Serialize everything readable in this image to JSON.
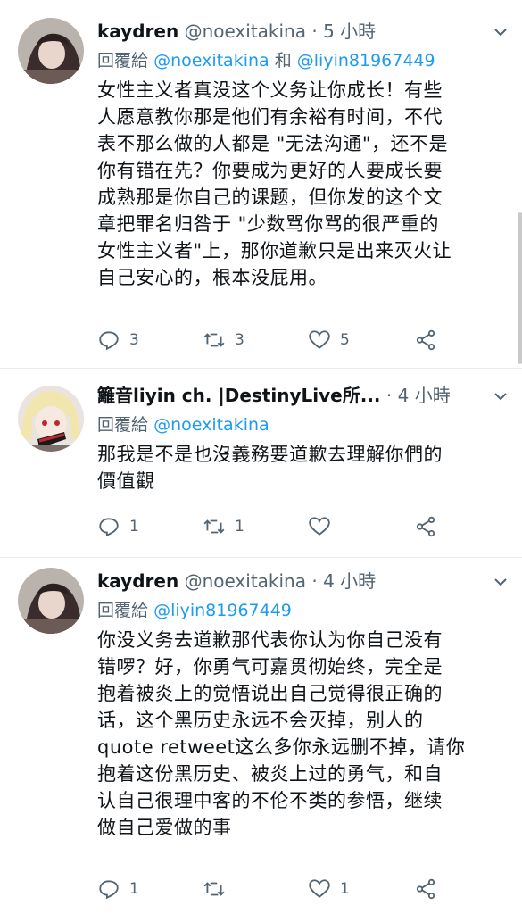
{
  "tweets": [
    {
      "name": "kaydren",
      "handle": "@noexitakina",
      "dot": "·",
      "time": "5 小時",
      "reply_prefix": "回覆給",
      "mentions": [
        "@noexitakina",
        "@liyin81967449"
      ],
      "mention_joiner": "和",
      "text_lines": [
        "女性主义者真没这个义务让你成长！有些",
        "人愿意教你那是他们有余裕有时间，不代",
        "表不那么做的人都是 \"无法沟通\"，还不是",
        "你有错在先？你要成为更好的人要成长要",
        "成熟那是你自己的课题，但你发的这个文",
        "章把罪名归咎于 \"少数骂你骂的很严重的",
        "女性主义者\"上，那你道歉只是出来灭火让",
        "自己安心的，根本没屁用。"
      ],
      "counts": {
        "reply": "3",
        "retweet": "3",
        "like": "5"
      }
    },
    {
      "name": "籬音liyin ch. |DestinyLive所...",
      "handle": "",
      "dot": "·",
      "time": "4 小時",
      "reply_prefix": "回覆給",
      "mentions": [
        "@noexitakina"
      ],
      "mention_joiner": "",
      "text_lines": [
        "那我是不是也沒義務要道歉去理解你們的",
        "價值觀"
      ],
      "counts": {
        "reply": "1",
        "retweet": "1",
        "like": ""
      }
    },
    {
      "name": "kaydren",
      "handle": "@noexitakina",
      "dot": "·",
      "time": "4 小時",
      "reply_prefix": "回覆給",
      "mentions": [
        "@liyin81967449"
      ],
      "mention_joiner": "",
      "text_lines": [
        "你没义务去道歉那代表你认为你自己没有",
        "错啰？好，你勇气可嘉贯彻始终，完全是",
        "抱着被炎上的觉悟说出自己觉得很正确的",
        "话，这个黑历史永远不会灭掉，别人的",
        "quote retweet这么多你永远删不掉，请你",
        "抱着这份黑历史、被炎上过的勇气，和自",
        "认自己很理中客的不伦不类的参悟，继续",
        "做自己爱做的事"
      ],
      "counts": {
        "reply": "1",
        "retweet": "",
        "like": "1"
      }
    }
  ],
  "icons": [
    "caret-down-icon",
    "reply-icon",
    "retweet-icon",
    "like-icon",
    "share-icon"
  ],
  "colors": {
    "text": "#0f1419",
    "muted": "#536471",
    "link": "#1d9bf0",
    "divider": "#e6ecf0"
  }
}
